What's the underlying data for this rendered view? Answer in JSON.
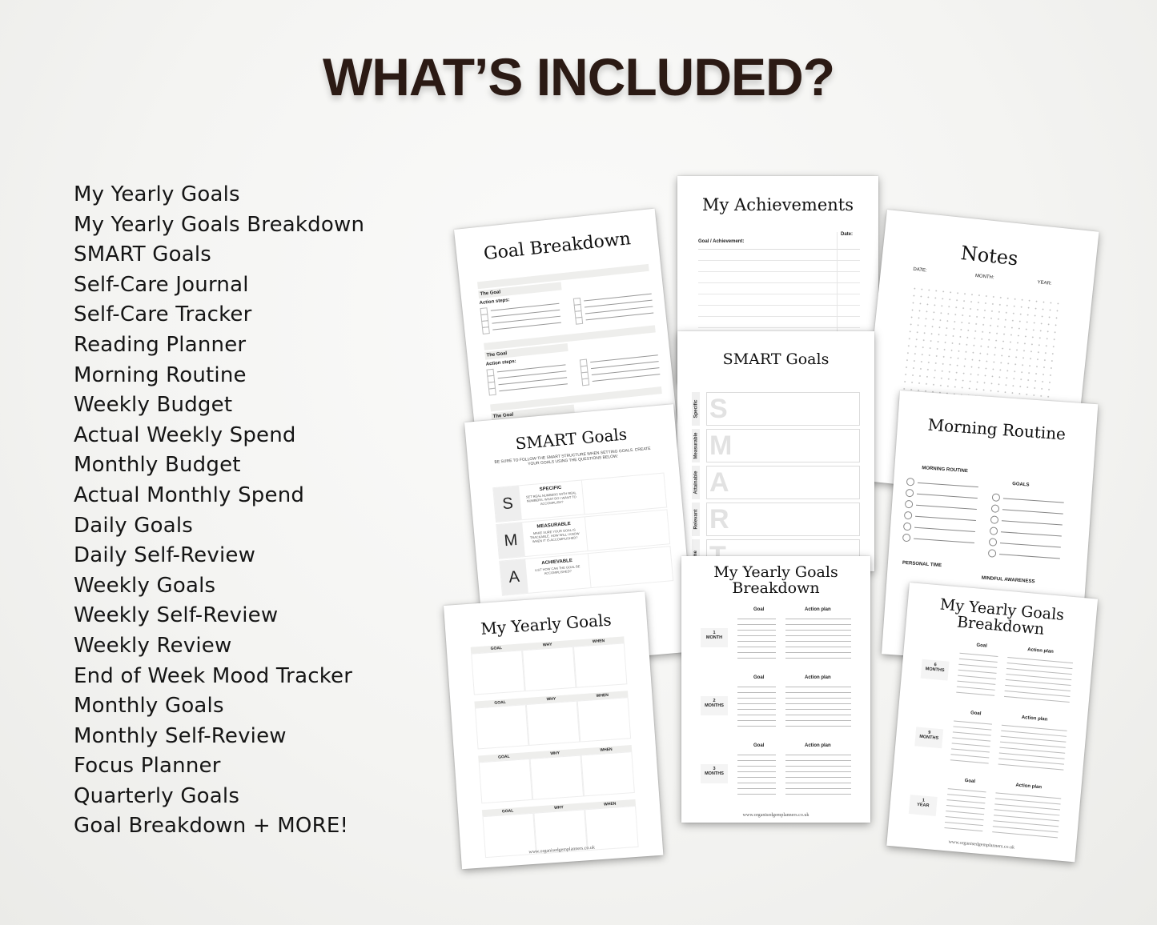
{
  "headline": "WHAT’S INCLUDED?",
  "included_items": [
    "My Yearly Goals",
    "My Yearly Goals Breakdown",
    "SMART Goals",
    "Self-Care Journal",
    "Self-Care Tracker",
    "Reading Planner",
    "Morning Routine",
    "Weekly Budget",
    "Actual Weekly Spend",
    "Monthly Budget",
    "Actual Monthly Spend",
    "Daily Goals",
    "Daily Self-Review",
    "Weekly Goals",
    "Weekly Self-Review",
    "Weekly Review",
    "End of Week Mood Tracker",
    "Monthly Goals",
    "Monthly Self-Review",
    "Focus Planner",
    "Quarterly Goals",
    "Goal Breakdown + MORE!"
  ],
  "pages": {
    "goal_breakdown": {
      "title": "Goal Breakdown",
      "section_label": "The Goal",
      "steps_label": "Action steps:"
    },
    "achievements": {
      "title": "My Achievements",
      "col_goal": "Goal / Achievement:",
      "col_date": "Date:"
    },
    "notes": {
      "title": "Notes",
      "date_label": "DATE:",
      "month_label": "MONTH:",
      "year_label": "YEAR:"
    },
    "smart_vertical": {
      "title": "SMART Goals",
      "rows": [
        {
          "side": "Specific",
          "letter": "S"
        },
        {
          "side": "Measurable",
          "letter": "M"
        },
        {
          "side": "Attainable",
          "letter": "A"
        },
        {
          "side": "Relevant",
          "letter": "R"
        },
        {
          "side": "Time",
          "letter": "T"
        }
      ]
    },
    "smart_tilted": {
      "title": "SMART Goals",
      "intro": "BE SURE TO FOLLOW THE SMART STRUCTURE WHEN SETTING GOALS. CREATE YOUR GOALS USING THE QUESTIONS BELOW:",
      "rows": [
        {
          "letter": "S",
          "heading": "SPECIFIC",
          "text": "SET REAL NUMBERS WITH REAL NUMBERS. WHAT DO I WANT TO ACCOMPLISH?"
        },
        {
          "letter": "M",
          "heading": "MEASURABLE",
          "text": "MAKE SURE YOUR GOAL IS TRACKABLE. HOW WILL I KNOW WHEN IT IS ACCOMPLISHED?"
        },
        {
          "letter": "A",
          "heading": "ACHIEVABLE",
          "text": "LIST HOW CAN THE GOAL BE ACCOMPLISHED?"
        }
      ]
    },
    "morning_routine": {
      "title": "Morning Routine",
      "col_routine": "MORNING ROUTINE",
      "col_goals": "GOALS",
      "personal_time": "PERSONAL TIME",
      "mindful_awareness": "MINDFUL AWARENESS"
    },
    "yearly_goals": {
      "title": "My Yearly Goals",
      "col_goal": "GOAL",
      "col_why": "WHY",
      "col_when": "WHEN",
      "footer": "www.organisedgemplanners.co.uk"
    },
    "yearly_breakdown_a": {
      "title_line1": "My Yearly Goals",
      "title_line2": "Breakdown",
      "goal_label": "Goal",
      "plan_label": "Action plan",
      "periods": [
        {
          "num": "1",
          "unit": "MONTH"
        },
        {
          "num": "2",
          "unit": "MONTHS"
        },
        {
          "num": "3",
          "unit": "MONTHS"
        }
      ],
      "footer": "www.organisedgemplanners.co.uk"
    },
    "yearly_breakdown_b": {
      "title_line1": "My Yearly Goals",
      "title_line2": "Breakdown",
      "goal_label": "Goal",
      "plan_label": "Action plan",
      "periods": [
        {
          "num": "6",
          "unit": "MONTHS"
        },
        {
          "num": "9",
          "unit": "MONTHS"
        },
        {
          "num": "1",
          "unit": "YEAR"
        }
      ],
      "footer": "www.organisedgemplanners.co.uk"
    }
  }
}
